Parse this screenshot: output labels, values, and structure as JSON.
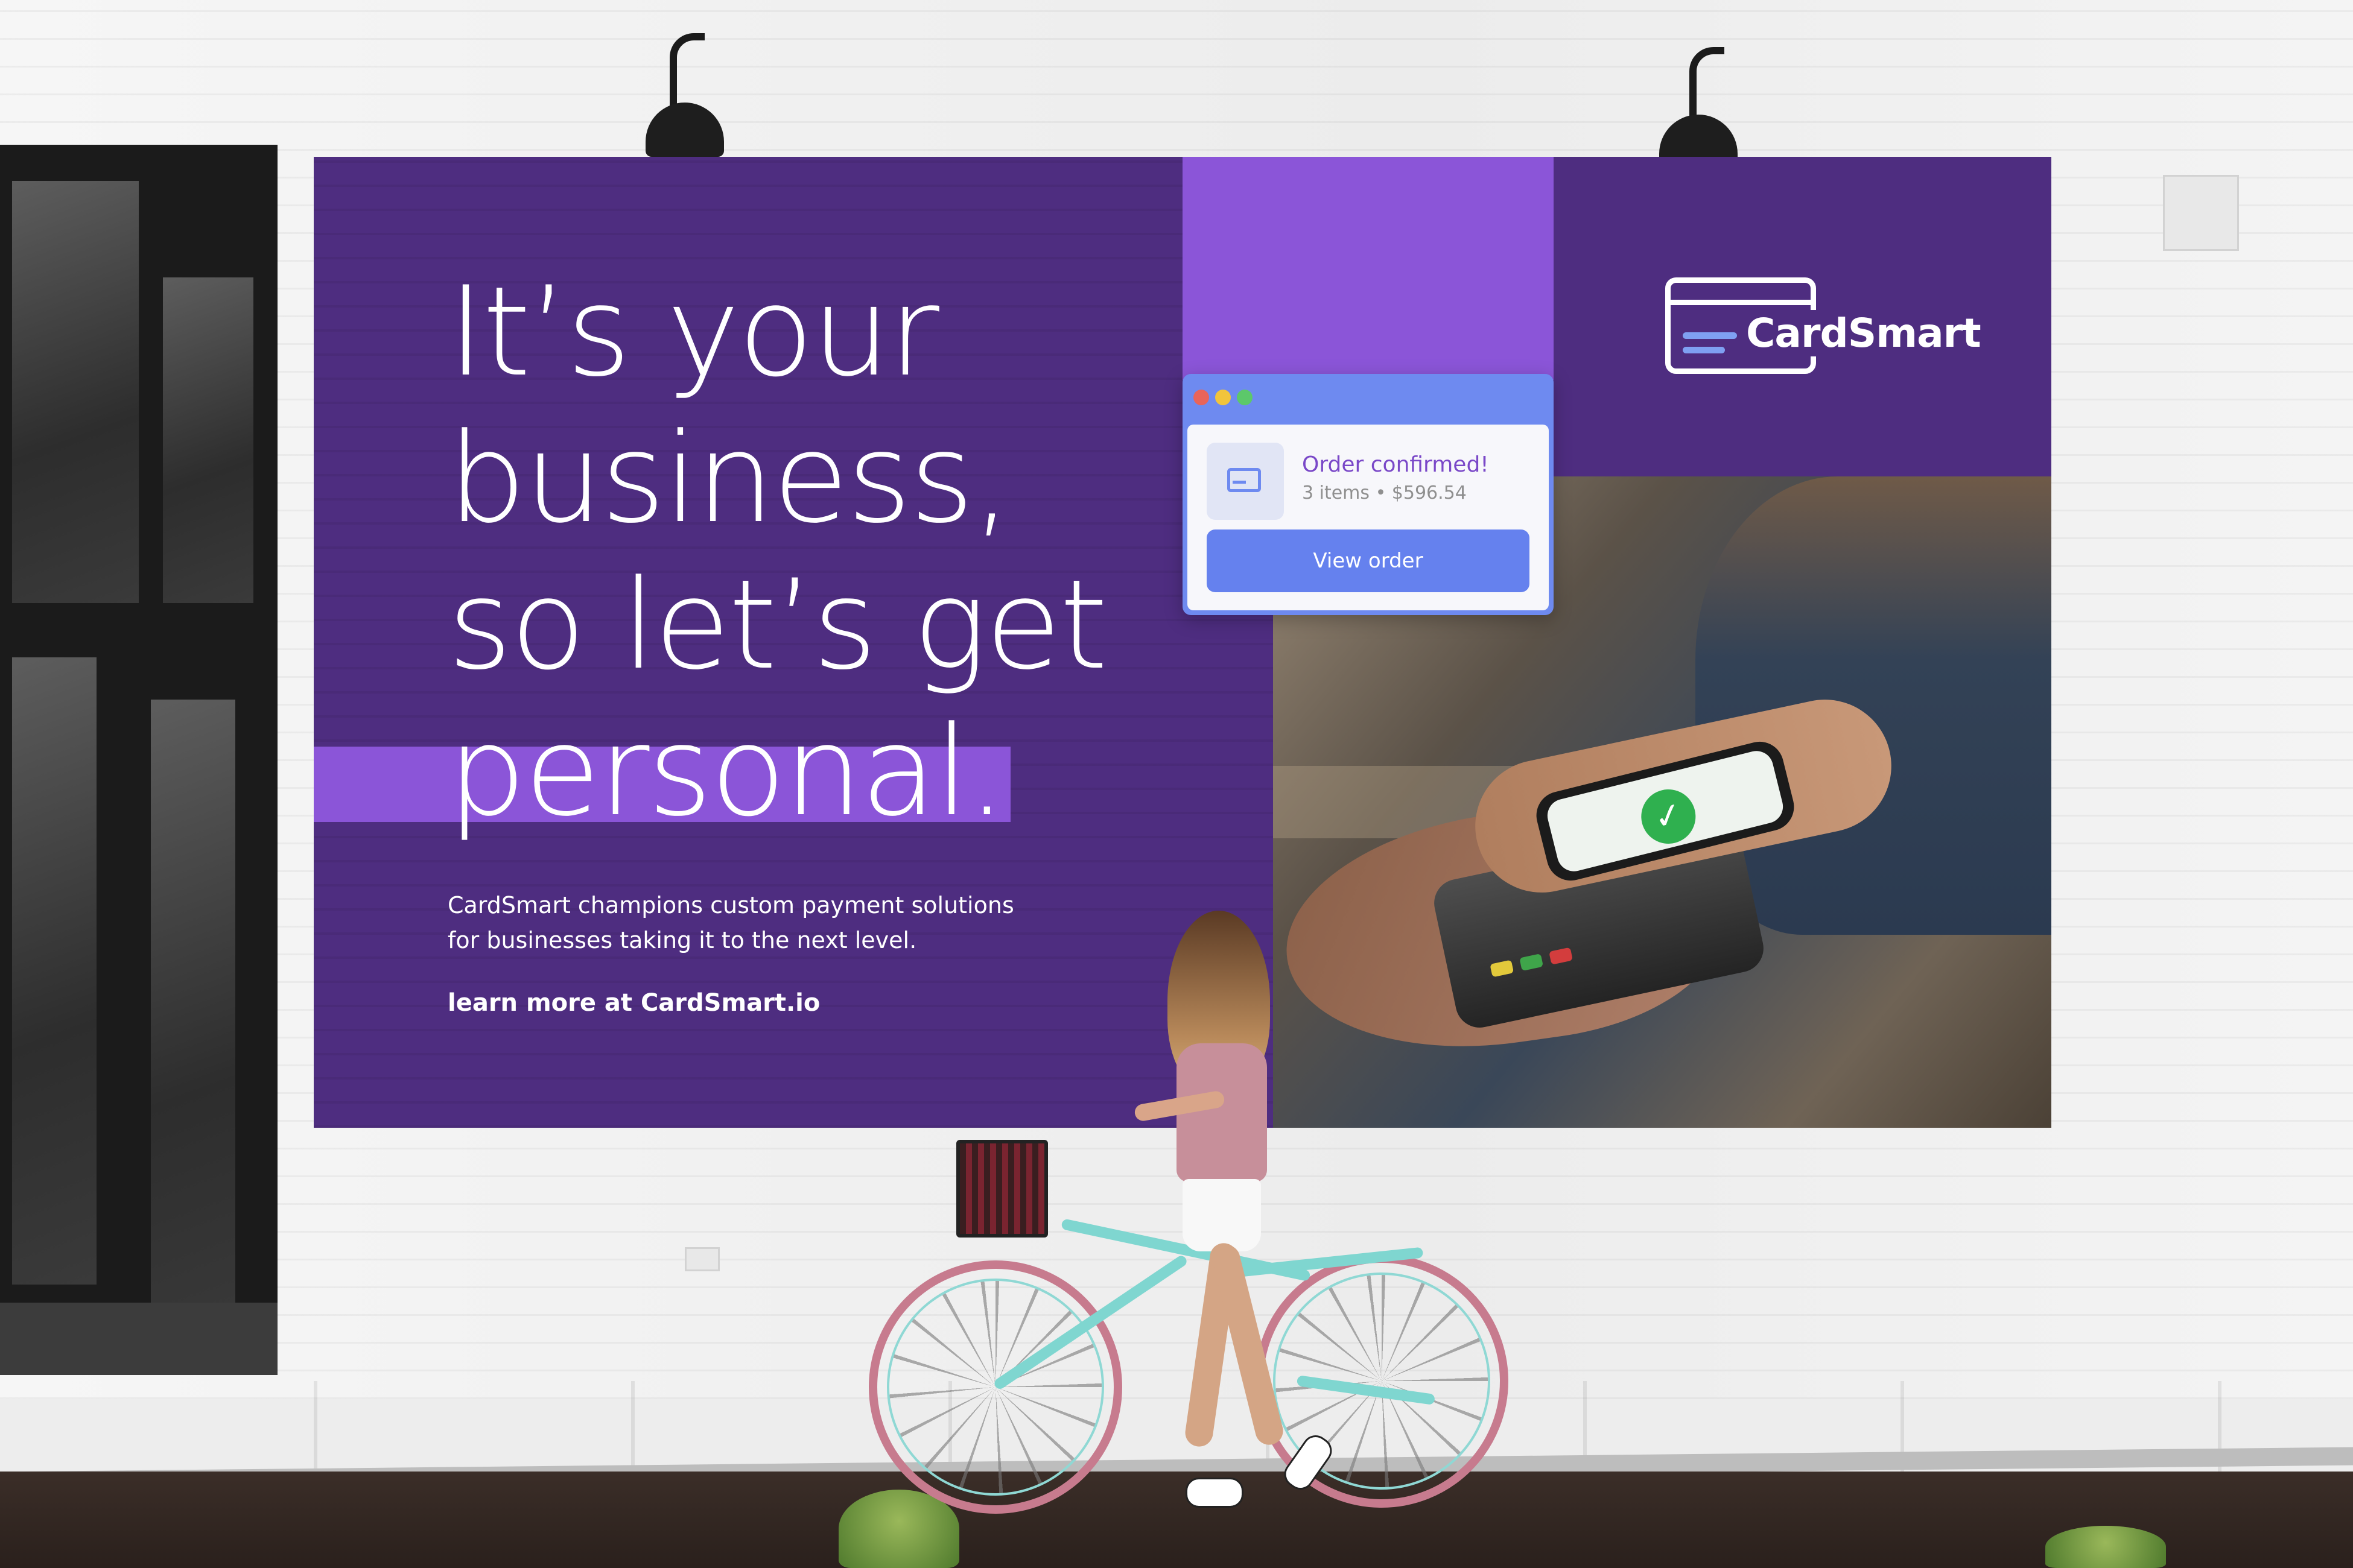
{
  "billboard": {
    "headline_lines": [
      "It’s your",
      "business,",
      "so let’s get",
      "personal."
    ],
    "body_lines": [
      "CardSmart champions custom payment solutions",
      "for businesses taking it to the next level."
    ],
    "cta": "learn more at CardSmart.io",
    "brand_name": "CardSmart",
    "colors": {
      "primary_purple": "#4e2d80",
      "accent_purple": "#8b55d8",
      "accent_blue": "#6e8af0",
      "order_title_purple": "#7a48c8"
    }
  },
  "order_card": {
    "window_dots": [
      "red",
      "yellow",
      "green"
    ],
    "icon": "credit-card-icon",
    "title": "Order confirmed!",
    "meta": "3 items • $596.54",
    "button_label": "View order"
  }
}
